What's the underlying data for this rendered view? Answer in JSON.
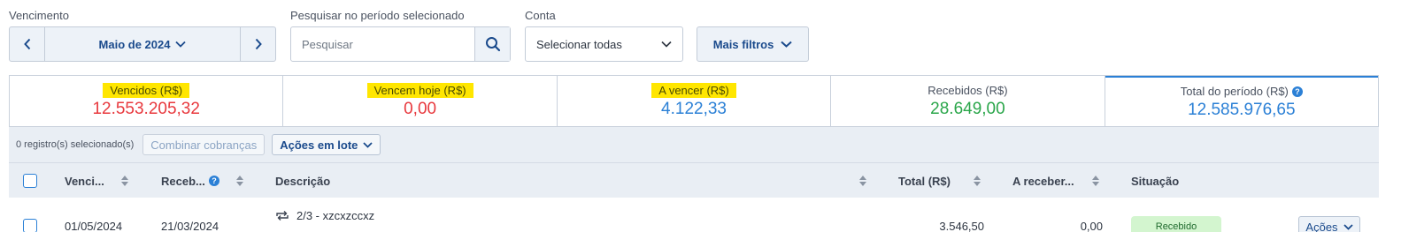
{
  "filters": {
    "due_label": "Vencimento",
    "month_value": "Maio de 2024",
    "search_label": "Pesquisar no período selecionado",
    "search_placeholder": "Pesquisar",
    "search_value": "",
    "account_label": "Conta",
    "account_value": "Selecionar todas",
    "more_filters_label": "Mais filtros"
  },
  "summary": [
    {
      "title": "Vencidos (R$)",
      "value": "12.553.205,32",
      "highlighted": true,
      "color": "#e8383d"
    },
    {
      "title": "Vencem hoje (R$)",
      "value": "0,00",
      "highlighted": true,
      "color": "#e8383d"
    },
    {
      "title": "A vencer (R$)",
      "value": "4.122,33",
      "highlighted": true,
      "color": "#2b80d6"
    },
    {
      "title": "Recebidos (R$)",
      "value": "28.649,00",
      "highlighted": false,
      "color": "#2aa64a"
    },
    {
      "title": "Total do período (R$)",
      "value": "12.585.976,65",
      "highlighted": false,
      "color": "#2b80d6",
      "selected": true
    }
  ],
  "toolbar": {
    "selected_count": "0 registro(s) selecionado(s)",
    "combine_label": "Combinar cobranças",
    "batch_label": "Ações em lote"
  },
  "table": {
    "columns": {
      "due": "Venci...",
      "received": "Receb...",
      "description": "Descrição",
      "total": "Total (R$)",
      "to_receive": "A receber...",
      "status": "Situação"
    },
    "rows": [
      {
        "due": "01/05/2024",
        "received": "21/03/2024",
        "installment": "2/3 - xzcxzccxz",
        "total": "3.546,50",
        "to_receive": "0,00",
        "status": "Recebido",
        "actions_label": "Ações"
      }
    ]
  },
  "icons": [
    "chevron-left-icon",
    "chevron-right-icon",
    "chevron-down-icon",
    "search-icon",
    "sort-icon",
    "help-icon",
    "recurrence-icon"
  ],
  "colors": {
    "accent": "#2b80d6",
    "link_dark": "#1a4a8c",
    "overdue": "#e8383d",
    "received": "#2aa64a",
    "highlight": "#ffe600",
    "badge_bg": "#d3f5cf"
  }
}
